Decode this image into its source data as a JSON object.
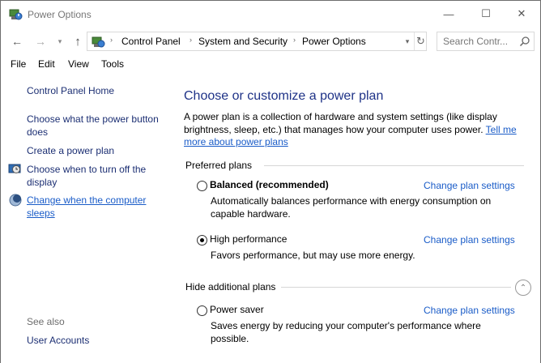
{
  "window": {
    "title": "Power Options",
    "controls": {
      "minimize": "—",
      "maximize": "☐",
      "close": "✕"
    }
  },
  "nav": {
    "back": "←",
    "forward": "→",
    "recent": "▾",
    "up": "↑",
    "breadcrumb": [
      "Control Panel",
      "System and Security",
      "Power Options"
    ],
    "separator": "›",
    "dropdown": "▾",
    "refresh": "↻",
    "search_placeholder": "Search Contr..."
  },
  "menu": [
    "File",
    "Edit",
    "View",
    "Tools"
  ],
  "sidebar": {
    "home": "Control Panel Home",
    "links": [
      "Choose what the power button does",
      "Create a power plan",
      "Choose when to turn off the display",
      "Change when the computer sleeps"
    ],
    "see_also": "See also",
    "see_also_links": [
      "User Accounts"
    ]
  },
  "main": {
    "help": "?",
    "title": "Choose or customize a power plan",
    "intro": "A power plan is a collection of hardware and system settings (like display brightness, sleep, etc.) that manages how your computer uses power.",
    "intro_link": "Tell me more about power plans",
    "preferred_label": "Preferred plans",
    "hidden_label": "Hide additional plans",
    "change_label": "Change plan settings",
    "plans": [
      {
        "name": "Balanced (recommended)",
        "desc": "Automatically balances performance with energy consumption on capable hardware.",
        "selected": false
      },
      {
        "name": "High performance",
        "desc": "Favors performance, but may use more energy.",
        "selected": true
      },
      {
        "name": "Power saver",
        "desc": "Saves energy by reducing your computer's performance where possible.",
        "selected": false
      }
    ],
    "collapse_icon": "⌃"
  },
  "colors": {
    "heading": "#1e3287",
    "link": "#1a5cc8",
    "nav_link": "#1c2f73",
    "help_badge": "#1d5fae"
  }
}
